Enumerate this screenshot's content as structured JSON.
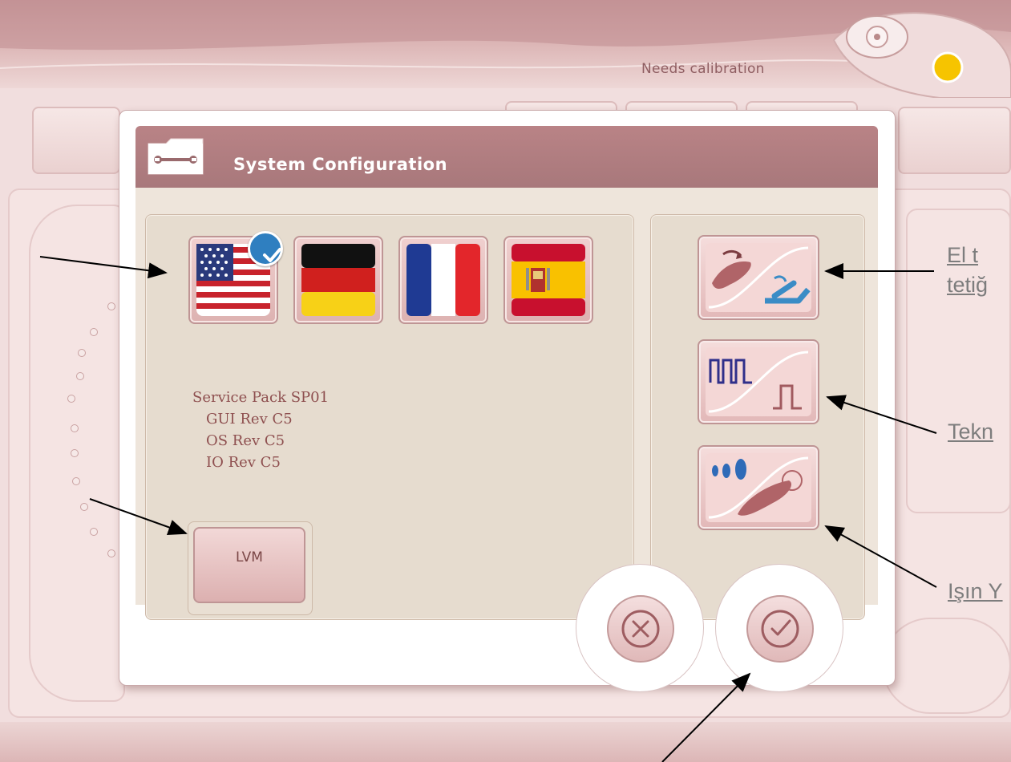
{
  "app": {
    "status_text": "Needs calibration"
  },
  "dialog": {
    "title": "System Configuration",
    "header_icon": "wrench-folder-icon",
    "languages": [
      {
        "name": "us-flag-icon",
        "selected": true
      },
      {
        "name": "germany-flag-icon",
        "selected": false
      },
      {
        "name": "france-flag-icon",
        "selected": false
      },
      {
        "name": "spain-flag-icon",
        "selected": false
      }
    ],
    "version": {
      "service_pack": "Service Pack SP01",
      "gui": "GUI Rev C5",
      "os": "OS Rev C5",
      "io": "IO Rev C5"
    },
    "lvm_label": "LVM",
    "tools": [
      {
        "icon": "handpiece-footswitch-icon"
      },
      {
        "icon": "pulse-mode-icon"
      },
      {
        "icon": "beam-spot-icon"
      }
    ],
    "cancel_icon": "cancel-icon",
    "confirm_icon": "confirm-check-icon"
  },
  "annotations": {
    "callout_1_line1": "El t",
    "callout_1_line2": "tetiğ",
    "callout_2": "Tekn",
    "callout_3": "Işın Y"
  },
  "colors": {
    "header": "#a8787b",
    "panel": "#e6dccf",
    "accent_blue": "#2f7fc0",
    "logo_dot": "#f6c400"
  }
}
